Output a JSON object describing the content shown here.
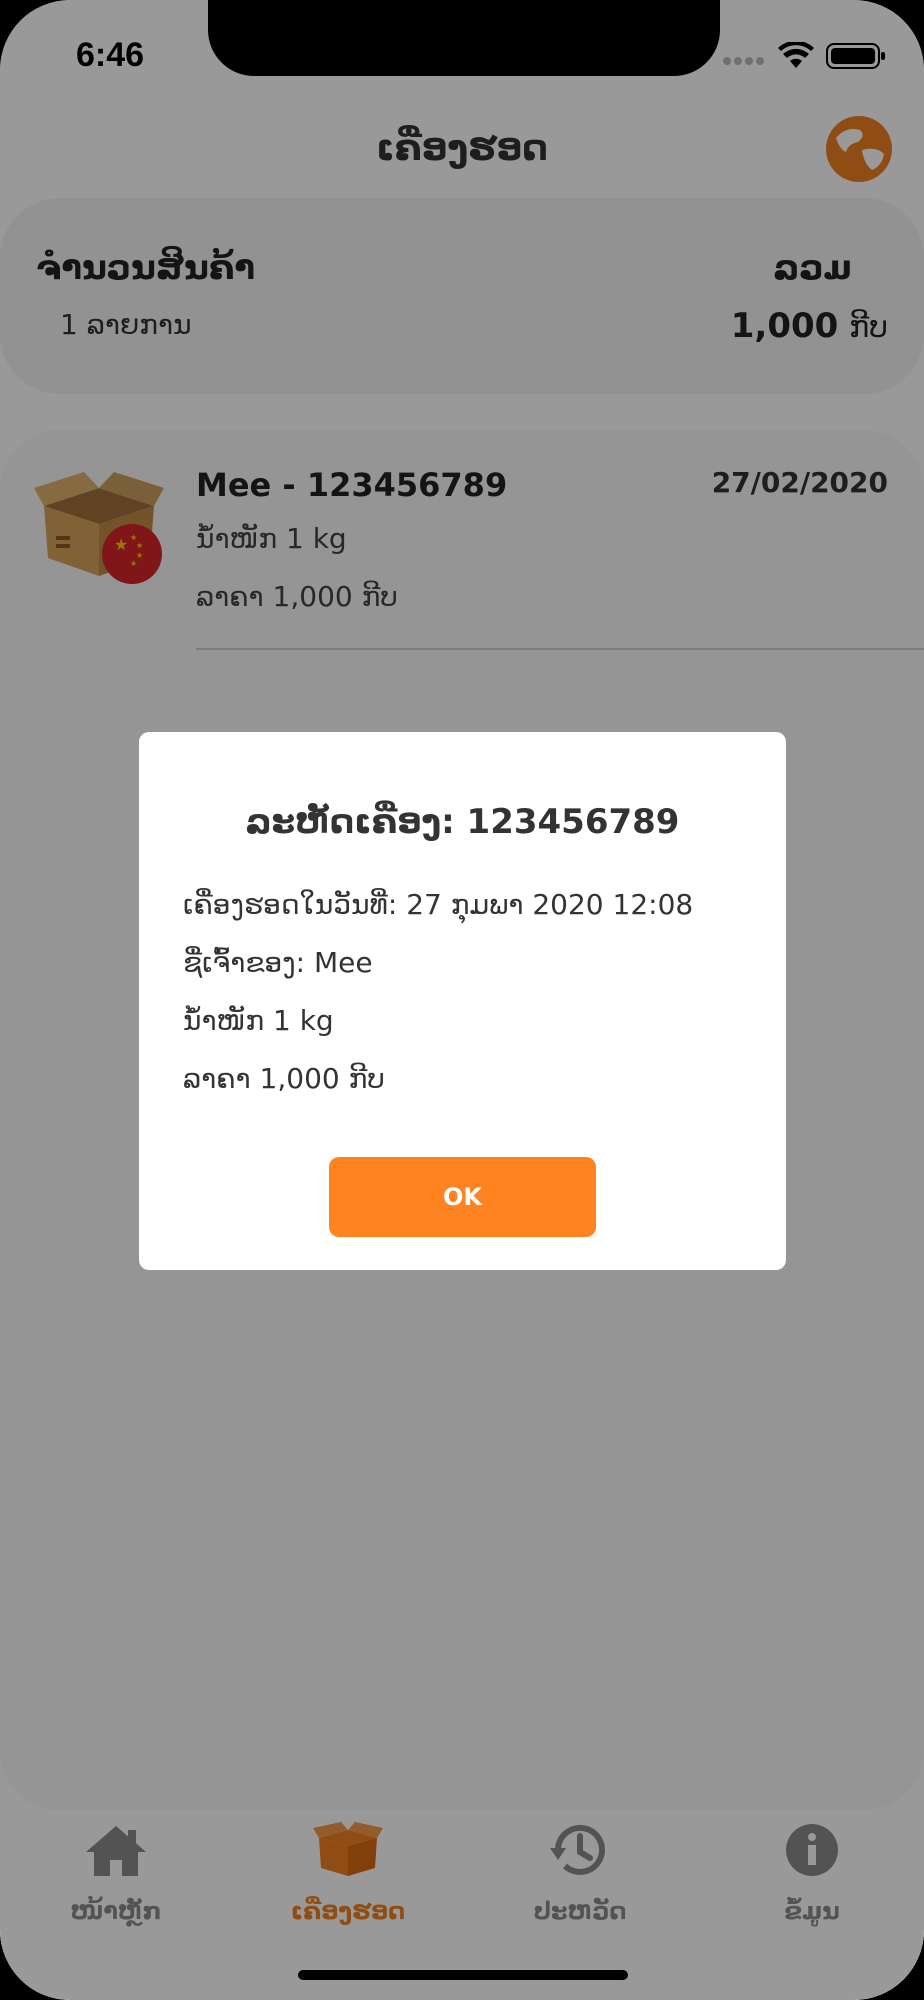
{
  "status_bar": {
    "time": "6:46"
  },
  "nav": {
    "title": "ເຄື່ອງຮອດ",
    "globe_icon": "globe-icon"
  },
  "summary": {
    "count_label": "ຈຳນວນສິນຄ້າ",
    "count_value": "1 ລາຍການ",
    "total_label": "ລວມ",
    "total_amount": "1,000",
    "total_unit": "ກີບ"
  },
  "item": {
    "title": "Mee - 123456789",
    "date": "27/02/2020",
    "weight": "ນ້ຳໜັກ 1 kg",
    "price": "ລາຄາ 1,000 ກີບ",
    "icon": "package-china-icon"
  },
  "dialog": {
    "title": "ລະຫັດເຄື່ອງ: 123456789",
    "arrived": "ເຄື່ອງຮອດໃນວັນທີ່: 27 ກຸມພາ 2020 12:08",
    "owner": "ຊື່ເຈົ້າຂອງ: Mee",
    "weight": "ນ້ຳໜັກ 1 kg",
    "price": "ລາຄາ 1,000 ກີບ",
    "ok_label": "OK"
  },
  "tabs": [
    {
      "label": "ໜ້າຫຼັກ",
      "icon": "home-icon",
      "active": false
    },
    {
      "label": "ເຄື່ອງຮອດ",
      "icon": "box-icon",
      "active": true
    },
    {
      "label": "ປະຫວັດ",
      "icon": "history-icon",
      "active": false
    },
    {
      "label": "ຂໍ້ມູນ",
      "icon": "info-icon",
      "active": false
    }
  ],
  "colors": {
    "accent": "#F08020",
    "button": "#FF8320",
    "inactive_tab": "#8A8A8A"
  }
}
